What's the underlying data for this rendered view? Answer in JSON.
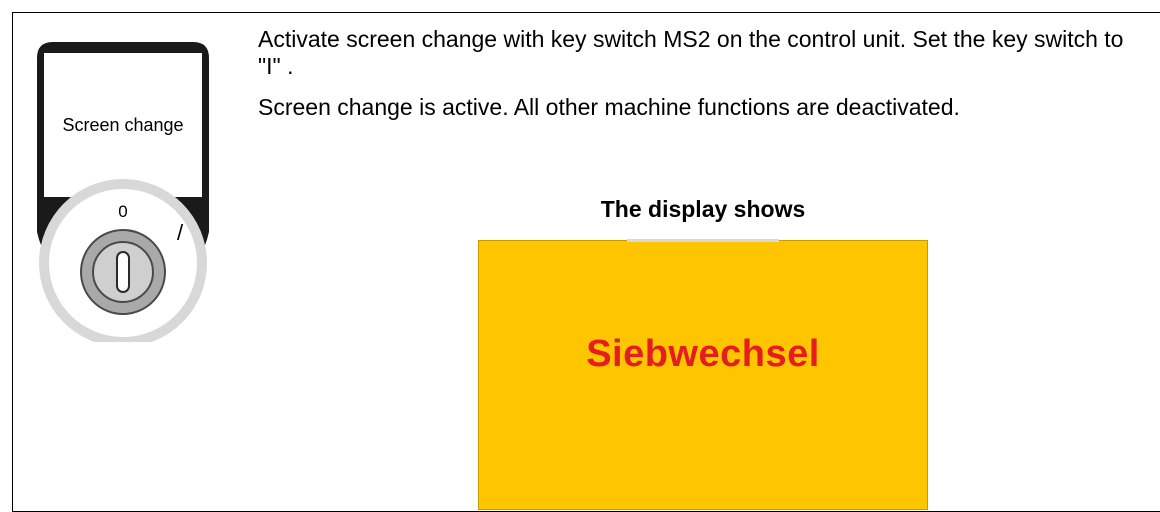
{
  "key_switch": {
    "label": "Screen change",
    "position_zero": "0",
    "position_one": "/"
  },
  "instructions": {
    "step_text": "Activate screen change with key switch MS2 on the control unit. Set the key switch to \"I\" .",
    "result_text": "Screen change is active. All other machine functions are deactivated."
  },
  "display": {
    "caption": "The display shows",
    "message": "Siebwechsel",
    "background_color": "#ffc600",
    "text_color": "#e41e1e"
  }
}
